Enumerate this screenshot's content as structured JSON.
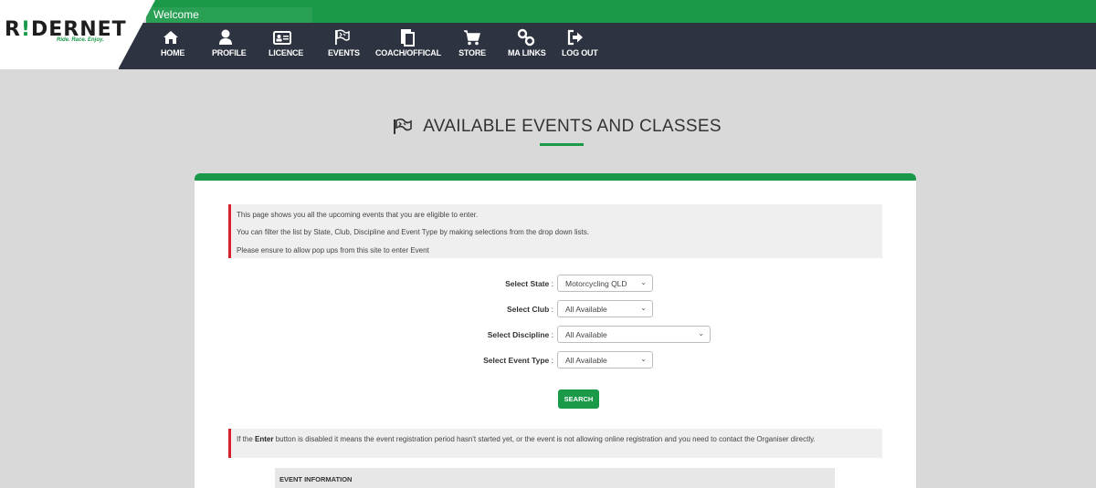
{
  "header": {
    "welcome": "Welcome",
    "logo_main": "RIDERNET",
    "logo_tagline": "Ride. Race. Enjoy.",
    "nav": [
      {
        "label": "HOME",
        "icon": "home-icon"
      },
      {
        "label": "PROFILE",
        "icon": "user-icon"
      },
      {
        "label": "LICENCE",
        "icon": "id-card-icon"
      },
      {
        "label": "EVENTS",
        "icon": "checkered-flag-icon"
      },
      {
        "label": "COACH/OFFICAL",
        "icon": "clipboard-icon"
      },
      {
        "label": "STORE",
        "icon": "cart-icon"
      },
      {
        "label": "MA LINKS",
        "icon": "link-icon"
      },
      {
        "label": "LOG OUT",
        "icon": "logout-icon"
      }
    ]
  },
  "main": {
    "title": "AVAILABLE EVENTS AND CLASSES",
    "info": [
      "This page shows you all the upcoming events that you are eligible to enter.",
      "You can filter the list by State, Club, Discipline and Event Type by making selections from the drop down lists.",
      "Please ensure to allow pop ups from this site to enter Event"
    ],
    "filters": {
      "state": {
        "label": "Select State",
        "value": "Motorcycling QLD"
      },
      "club": {
        "label": "Select Club",
        "value": "All Available"
      },
      "discipline": {
        "label": "Select Discipline",
        "value": "All Available"
      },
      "event_type": {
        "label": "Select Event Type",
        "value": "All Available"
      }
    },
    "search_label": "SEARCH",
    "notice_prefix": "If the ",
    "notice_bold": "Enter",
    "notice_suffix": " button is disabled it means the event registration period hasn't started yet, or the event is not allowing online registration and you need to contact the Organiser directly.",
    "event_info_heading": "EVENT INFORMATION"
  },
  "colors": {
    "brand_green": "#1a9a49",
    "nav_dark": "#2d3340",
    "alert_red": "#d6202a",
    "background": "#d9d9d9"
  }
}
